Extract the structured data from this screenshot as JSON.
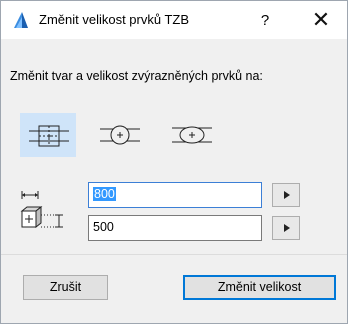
{
  "window": {
    "title": "Změnit velikost prvků TZB",
    "help_label": "?",
    "close_label": "✕"
  },
  "prompt": "Změnit tvar a velikost zvýrazněných prvků na:",
  "shape_options": [
    {
      "name": "rectangular",
      "selected": true
    },
    {
      "name": "circular",
      "selected": false
    },
    {
      "name": "oval",
      "selected": false
    }
  ],
  "dimensions": {
    "width_value": "800",
    "height_value": "500"
  },
  "buttons": {
    "cancel": "Zrušit",
    "resize": "Změnit velikost"
  },
  "colors": {
    "selection": "#cfe4f9",
    "accent": "#0078d7"
  }
}
